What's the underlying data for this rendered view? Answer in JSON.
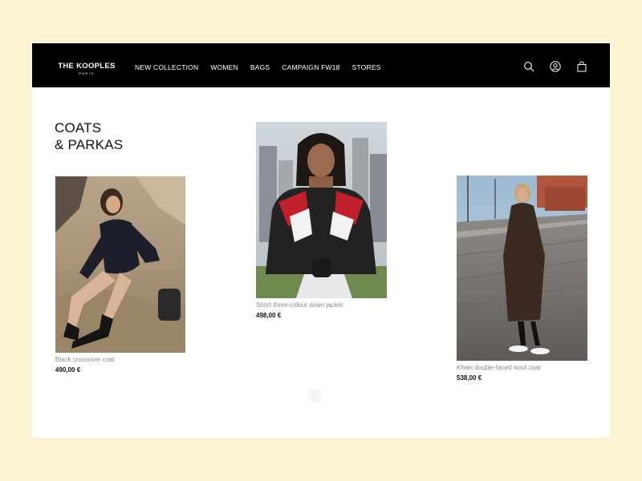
{
  "brand": {
    "name": "THE KOOPLES",
    "sub": "PARIS"
  },
  "nav": {
    "links": [
      "NEW COLLECTION",
      "WOMEN",
      "BAGS",
      "CAMPAIGN FW18",
      "STORES"
    ],
    "icons": [
      "search-icon",
      "account-icon",
      "shopping-bag-icon"
    ]
  },
  "category": {
    "line1": "COATS",
    "line2": "& PARKAS"
  },
  "products": [
    {
      "name": "Black crossover coat",
      "price": "490,00 €"
    },
    {
      "name": "Short three-colour down jacket",
      "price": "498,00 €"
    },
    {
      "name": "Khaki double-faced wool coat",
      "price": "538,00 €"
    }
  ],
  "colors": {
    "page_bg": "#fbf3d2",
    "navbar_bg": "#000000",
    "text": "#111111",
    "muted": "#8a8a8a"
  }
}
